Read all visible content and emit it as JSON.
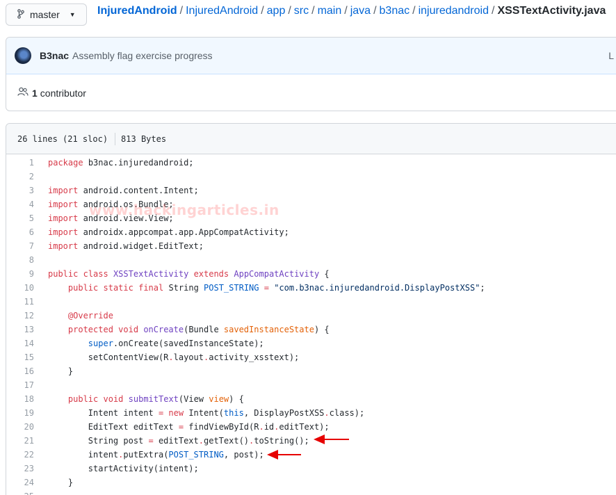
{
  "branch": {
    "label": "master"
  },
  "breadcrumb": [
    {
      "label": "InjuredAndroid",
      "kind": "repo"
    },
    {
      "label": "InjuredAndroid",
      "kind": "dir"
    },
    {
      "label": "app",
      "kind": "dir"
    },
    {
      "label": "src",
      "kind": "dir"
    },
    {
      "label": "main",
      "kind": "dir"
    },
    {
      "label": "java",
      "kind": "dir"
    },
    {
      "label": "b3nac",
      "kind": "dir"
    },
    {
      "label": "injuredandroid",
      "kind": "dir"
    },
    {
      "label": "XSSTextActivity.java",
      "kind": "file"
    }
  ],
  "breadcrumb_separator": "/",
  "commit": {
    "author": "B3nac",
    "message": "Assembly flag exercise progress",
    "right_fragment": "L"
  },
  "contributors": {
    "count": "1",
    "label": "contributor"
  },
  "file_info": {
    "lines": "26 lines (21 sloc)",
    "size": "813 Bytes"
  },
  "watermark": "www.hackingarticles.in",
  "code_lines": [
    {
      "n": "1",
      "tokens": [
        [
          "k",
          "package"
        ],
        [
          "",
          "b3nac.injuredandroid;"
        ]
      ]
    },
    {
      "n": "2",
      "tokens": []
    },
    {
      "n": "3",
      "tokens": [
        [
          "k",
          "import"
        ],
        [
          "",
          "android.content.Intent;"
        ]
      ]
    },
    {
      "n": "4",
      "tokens": [
        [
          "k",
          "import"
        ],
        [
          "",
          "android.os.Bundle;"
        ]
      ]
    },
    {
      "n": "5",
      "tokens": [
        [
          "k",
          "import"
        ],
        [
          "",
          "android.view.View;"
        ]
      ]
    },
    {
      "n": "6",
      "tokens": [
        [
          "k",
          "import"
        ],
        [
          "",
          "androidx.appcompat.app.AppCompatActivity;"
        ]
      ]
    },
    {
      "n": "7",
      "tokens": [
        [
          "k",
          "import"
        ],
        [
          "",
          "android.widget.EditText;"
        ]
      ]
    },
    {
      "n": "8",
      "tokens": []
    },
    {
      "n": "9",
      "tokens": [
        [
          "k",
          "public"
        ],
        [
          "",
          " "
        ],
        [
          "k",
          "class"
        ],
        [
          "",
          " "
        ],
        [
          "en",
          "XSSTextActivity"
        ],
        [
          "",
          " "
        ],
        [
          "k",
          "extends"
        ],
        [
          "",
          " "
        ],
        [
          "en",
          "AppCompatActivity"
        ],
        [
          "",
          " {"
        ]
      ]
    },
    {
      "n": "10",
      "tokens": [
        [
          "",
          "    "
        ],
        [
          "k",
          "public"
        ],
        [
          "",
          " "
        ],
        [
          "k",
          "static"
        ],
        [
          "",
          " "
        ],
        [
          "k",
          "final"
        ],
        [
          "",
          " String "
        ],
        [
          "c1",
          "POST_STRING"
        ],
        [
          "",
          " "
        ],
        [
          "k",
          "="
        ],
        [
          "",
          " "
        ],
        [
          "s",
          "\"com.b3nac.injuredandroid.DisplayPostXSS\""
        ],
        [
          "",
          ";"
        ]
      ]
    },
    {
      "n": "11",
      "tokens": []
    },
    {
      "n": "12",
      "tokens": [
        [
          "",
          "    "
        ],
        [
          "k",
          "@Override"
        ]
      ]
    },
    {
      "n": "13",
      "tokens": [
        [
          "",
          "    "
        ],
        [
          "k",
          "protected"
        ],
        [
          "",
          " "
        ],
        [
          "k",
          "void"
        ],
        [
          "",
          " "
        ],
        [
          "en",
          "onCreate"
        ],
        [
          "",
          "(Bundle "
        ],
        [
          "v",
          "savedInstanceState"
        ],
        [
          "",
          ") {"
        ]
      ]
    },
    {
      "n": "14",
      "tokens": [
        [
          "",
          "        "
        ],
        [
          "c1",
          "super"
        ],
        [
          "",
          ".onCreate(savedInstanceState);"
        ]
      ]
    },
    {
      "n": "15",
      "tokens": [
        [
          "",
          "        setContentView(R"
        ],
        [
          "k",
          "."
        ],
        [
          "",
          "layout"
        ],
        [
          "k",
          "."
        ],
        [
          "",
          "activity_xsstext);"
        ]
      ]
    },
    {
      "n": "16",
      "tokens": [
        [
          "",
          "    }"
        ]
      ]
    },
    {
      "n": "17",
      "tokens": []
    },
    {
      "n": "18",
      "tokens": [
        [
          "",
          "    "
        ],
        [
          "k",
          "public"
        ],
        [
          "",
          " "
        ],
        [
          "k",
          "void"
        ],
        [
          "",
          " "
        ],
        [
          "en",
          "submitText"
        ],
        [
          "",
          "(View "
        ],
        [
          "v",
          "view"
        ],
        [
          "",
          ") {"
        ]
      ]
    },
    {
      "n": "19",
      "tokens": [
        [
          "",
          "        Intent intent "
        ],
        [
          "k",
          "="
        ],
        [
          "",
          " "
        ],
        [
          "k",
          "new"
        ],
        [
          "",
          " Intent("
        ],
        [
          "c1",
          "this"
        ],
        [
          "",
          ", DisplayPostXSS"
        ],
        [
          "k",
          "."
        ],
        [
          "",
          "class);"
        ]
      ]
    },
    {
      "n": "20",
      "tokens": [
        [
          "",
          "        EditText editText "
        ],
        [
          "k",
          "="
        ],
        [
          "",
          " findViewById(R"
        ],
        [
          "k",
          "."
        ],
        [
          "",
          "id"
        ],
        [
          "k",
          "."
        ],
        [
          "",
          "editText);"
        ]
      ]
    },
    {
      "n": "21",
      "tokens": [
        [
          "",
          "        String post "
        ],
        [
          "k",
          "="
        ],
        [
          "",
          " editText"
        ],
        [
          "k",
          "."
        ],
        [
          "",
          "getText()"
        ],
        [
          "k",
          "."
        ],
        [
          "",
          "toString();"
        ]
      ]
    },
    {
      "n": "22",
      "tokens": [
        [
          "",
          "        intent"
        ],
        [
          "k",
          "."
        ],
        [
          "",
          "putExtra("
        ],
        [
          "c1",
          "POST_STRING"
        ],
        [
          "",
          ", post);"
        ]
      ]
    },
    {
      "n": "23",
      "tokens": [
        [
          "",
          "        startActivity(intent);"
        ]
      ]
    },
    {
      "n": "24",
      "tokens": [
        [
          "",
          "    }"
        ]
      ]
    },
    {
      "n": "25",
      "tokens": []
    }
  ],
  "colors": {
    "link": "#0366d6",
    "keyword": "#d73a49",
    "entity": "#6f42c1",
    "constant": "#005cc5",
    "string": "#032f62",
    "variable": "#e36209",
    "arrow": "#e60000"
  },
  "icons": [
    "git-branch-icon",
    "caret-down-icon",
    "people-icon",
    "red-arrow-icon"
  ]
}
